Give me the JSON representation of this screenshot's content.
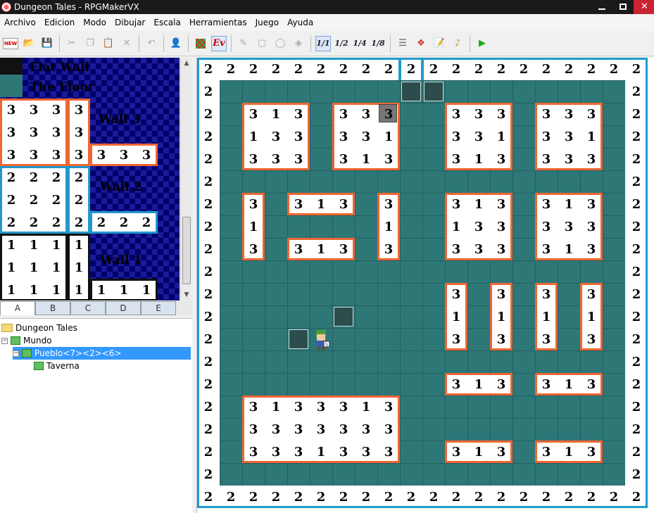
{
  "window": {
    "title": "Dungeon Tales - RPGMakerVX",
    "icon": "rpgmaker-app-icon"
  },
  "menu": [
    "Archivo",
    "Edicion",
    "Modo",
    "Dibujar",
    "Escala",
    "Herramientas",
    "Juego",
    "Ayuda"
  ],
  "toolbar": {
    "new_label": "NEW",
    "layer_labels": [
      "1/1",
      "1/2",
      "1/4",
      "1/8"
    ],
    "event_label": "Ev"
  },
  "tileset": {
    "labels": [
      "Flat Wall",
      "The Floor",
      "Wall 3",
      "Wall 2",
      "Wall 1"
    ],
    "groups": [
      {
        "name": "wall-3",
        "digit": "3",
        "color": "#ee6633"
      },
      {
        "name": "wall-2",
        "digit": "2",
        "color": "#2299cc"
      },
      {
        "name": "wall-1",
        "digit": "1",
        "color": "#111111"
      }
    ]
  },
  "tabs": [
    "A",
    "B",
    "C",
    "D",
    "E"
  ],
  "tree": [
    {
      "label": "Dungeon Tales",
      "icon": "folder-icon",
      "expander": ""
    },
    {
      "label": "Mundo",
      "icon": "map-icon",
      "expander": "−"
    },
    {
      "label": "Pueblo<7><2><6>",
      "icon": "map-icon",
      "expander": "−"
    },
    {
      "label": "Taverna",
      "icon": "map-icon",
      "expander": ""
    }
  ],
  "map": {
    "border_digit": "2",
    "wall_digits": {
      "b1": [
        [
          "3",
          "1",
          "3"
        ],
        [
          "1",
          "3",
          "3"
        ],
        [
          "3",
          "3",
          "3"
        ]
      ],
      "b2": [
        [
          "3",
          "3",
          "3"
        ],
        [
          "3",
          "3",
          "1"
        ],
        [
          "3",
          "1",
          "3"
        ]
      ],
      "b3": [
        [
          "3",
          "3",
          "3"
        ],
        [
          "3",
          "3",
          "1"
        ],
        [
          "3",
          "1",
          "3"
        ]
      ],
      "b4": [
        [
          "3",
          "3",
          "3"
        ],
        [
          "3",
          "3",
          "1"
        ],
        [
          "3",
          "3",
          "3"
        ]
      ],
      "b5": [
        [
          "3",
          "1",
          "3"
        ],
        [
          "1",
          "3",
          "3"
        ],
        [
          "3",
          "3",
          "3"
        ]
      ],
      "b6": [
        [
          "3",
          "1",
          "3"
        ],
        [
          "3",
          "3",
          "3"
        ],
        [
          "3",
          "1",
          "3"
        ]
      ],
      "b7": [
        [
          "3",
          "1",
          "3",
          "3",
          "3",
          "1",
          "3"
        ],
        [
          "3",
          "3",
          "3",
          "3",
          "3",
          "3",
          "3"
        ],
        [
          "3",
          "3",
          "3",
          "1",
          "3",
          "3",
          "3"
        ]
      ],
      "small_col_left": [
        "3",
        "1",
        "3"
      ],
      "small_col_mid": [
        "3",
        "1",
        "3"
      ],
      "small_row_top": [
        "3",
        "1",
        "3"
      ],
      "small_row_bot": [
        "3",
        "1",
        "3"
      ],
      "pillars": [
        "3",
        "1",
        "3"
      ],
      "row_pairs": [
        "3",
        "1",
        "3"
      ]
    }
  }
}
